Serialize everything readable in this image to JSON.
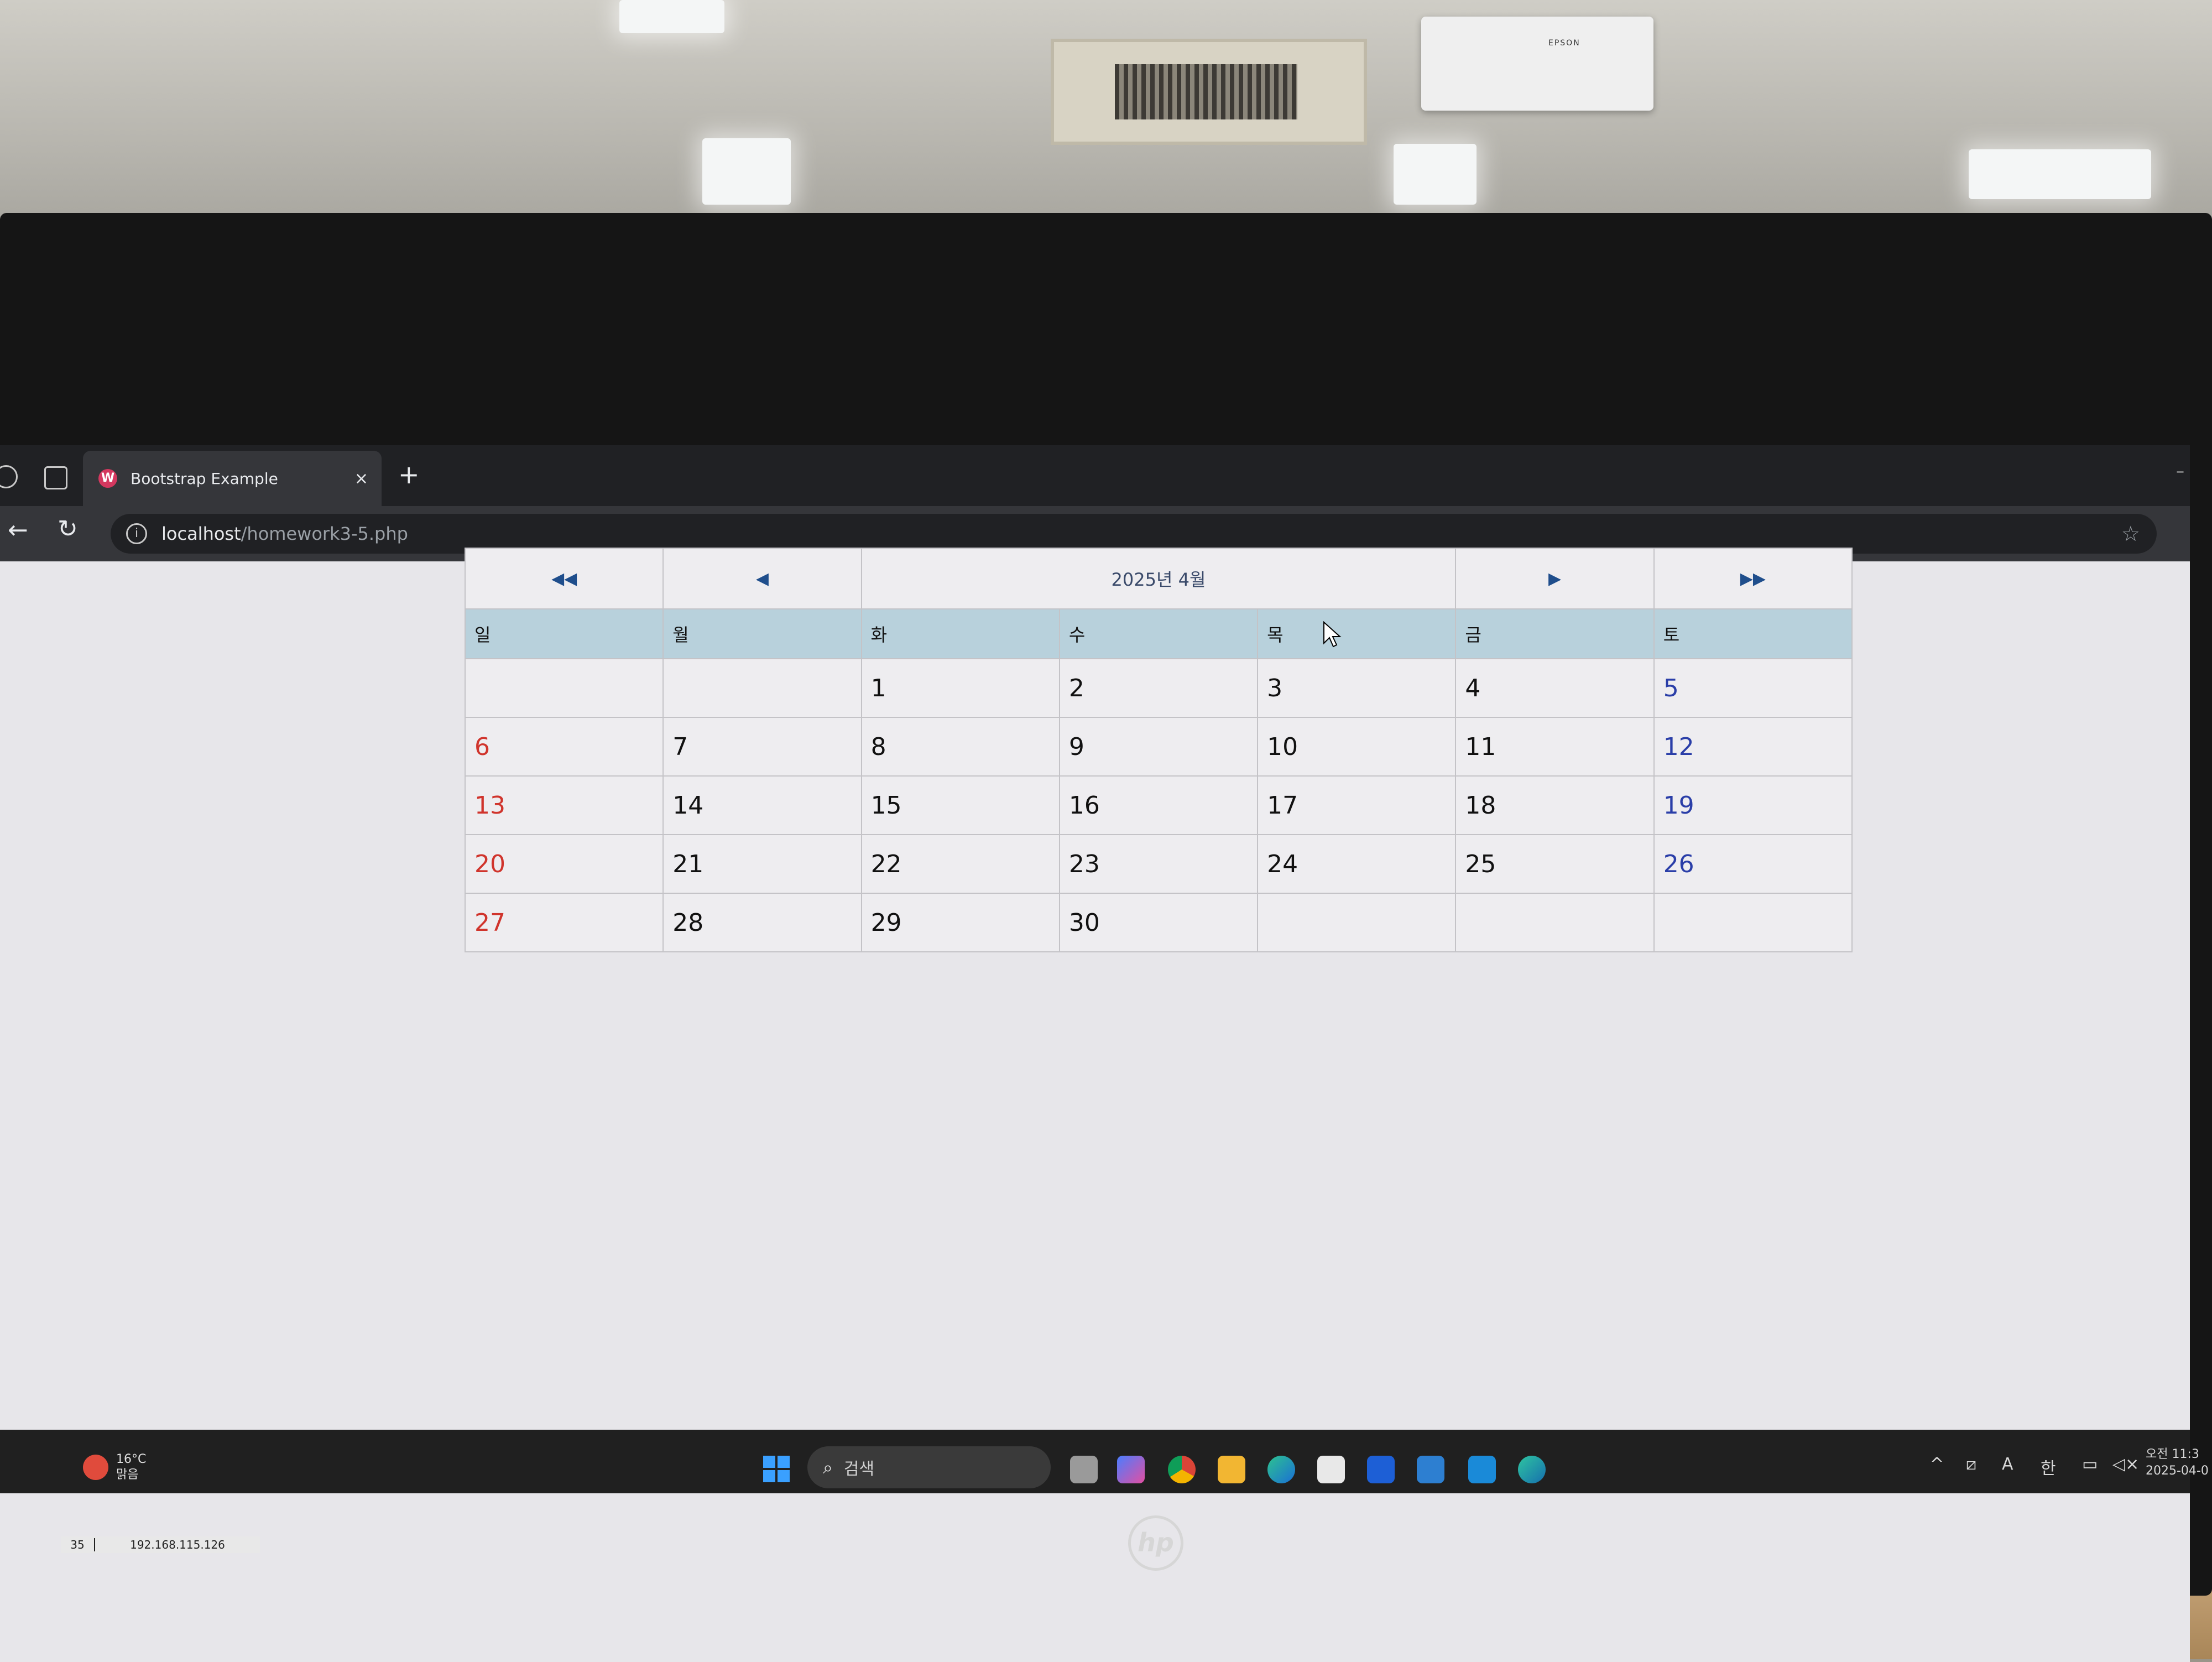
{
  "projector_brand": "EPSON",
  "browser": {
    "tab_title": "Bootstrap Example",
    "tab_close": "×",
    "new_tab": "+",
    "url_host": "localhost",
    "url_path": "/homework3-5.php",
    "back_icon": "arrow-left-icon",
    "reload_icon": "reload-icon"
  },
  "calendar": {
    "prev_year": "◀◀",
    "prev_month": "◀",
    "month_label": "2025년 4월",
    "next_month": "▶",
    "next_year": "▶▶",
    "weekdays": [
      "일",
      "월",
      "화",
      "수",
      "목",
      "금",
      "토"
    ],
    "weeks": [
      [
        "",
        "",
        "1",
        "2",
        "3",
        "4",
        "5"
      ],
      [
        "6",
        "7",
        "8",
        "9",
        "10",
        "11",
        "12"
      ],
      [
        "13",
        "14",
        "15",
        "16",
        "17",
        "18",
        "19"
      ],
      [
        "20",
        "21",
        "22",
        "23",
        "24",
        "25",
        "26"
      ],
      [
        "27",
        "28",
        "29",
        "30",
        "",
        "",
        ""
      ]
    ],
    "colors": {
      "sunday": "#d0342c",
      "saturday": "#2a3ea8",
      "header_bg": "#b8d1dc"
    }
  },
  "taskbar": {
    "weather_temp": "16°C",
    "weather_desc": "맑음",
    "search_label": "검색",
    "ime_label": "한",
    "font_label": "A",
    "clock_time": "오전 11:3",
    "clock_date": "2025-04-0"
  },
  "sticker": {
    "num": "35",
    "ip": "192.168.115.126"
  },
  "hp_logo": "hp"
}
